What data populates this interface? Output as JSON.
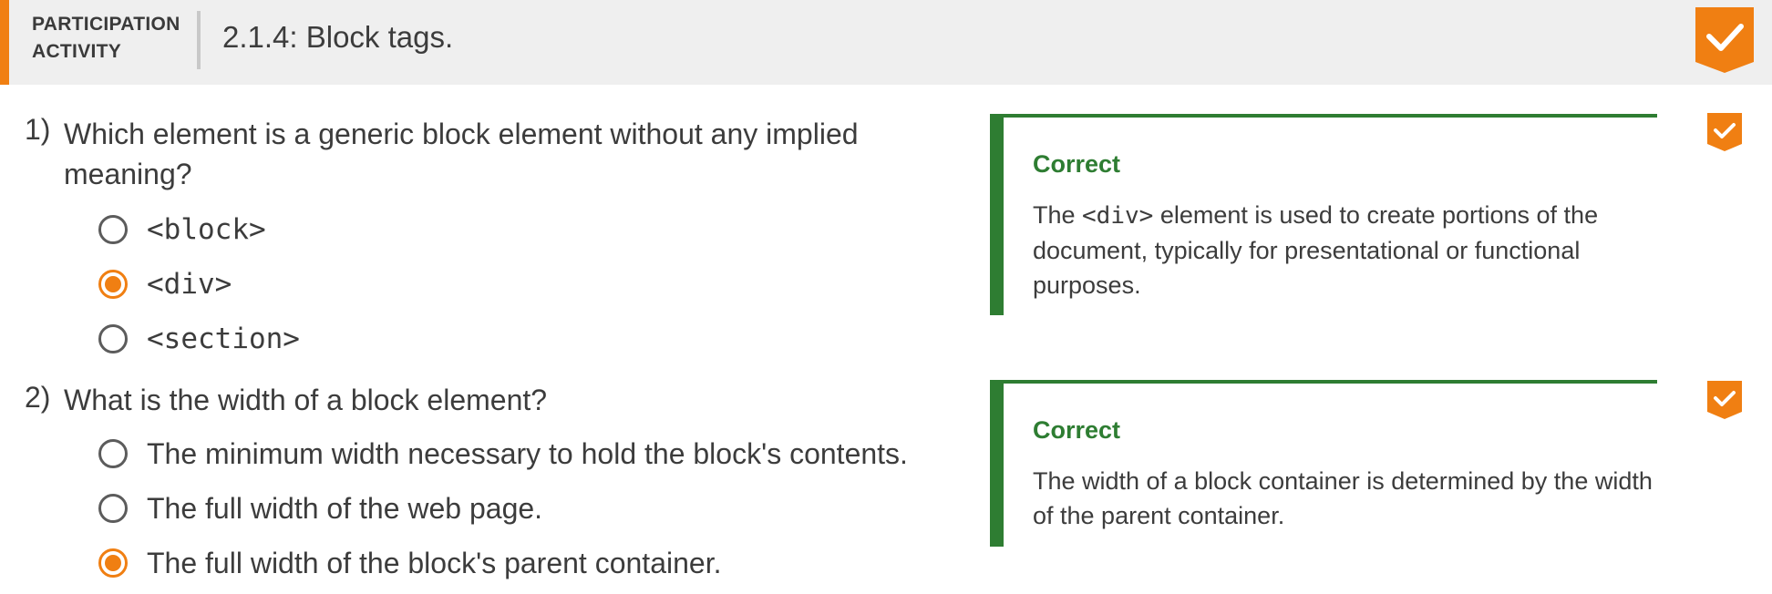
{
  "header": {
    "participation_line1": "PARTICIPATION",
    "participation_line2": "ACTIVITY",
    "title": "2.1.4: Block tags.",
    "completion_icon": "check-badge-icon"
  },
  "colors": {
    "accent": "#f07f12",
    "correct": "#2e7d32",
    "header_bg": "#efefef",
    "text": "#3c3c3c"
  },
  "questions": [
    {
      "number": "1)",
      "text": "Which element is a generic block element without any implied meaning?",
      "options": [
        {
          "label": "<block>",
          "selected": false
        },
        {
          "label": "<div>",
          "selected": true
        },
        {
          "label": "<section>",
          "selected": false
        }
      ],
      "feedback": {
        "title": "Correct",
        "body_before": "The ",
        "body_code": "<div>",
        "body_after": " element is used to create portions of the document, typically for presentational or functional purposes."
      },
      "status_icon": "check-badge-icon"
    },
    {
      "number": "2)",
      "text": "What is the width of a block element?",
      "options": [
        {
          "label": "The minimum width necessary to hold the block's contents.",
          "selected": false
        },
        {
          "label": "The full width of the web page.",
          "selected": false
        },
        {
          "label": "The full width of the block's parent container.",
          "selected": true
        }
      ],
      "feedback": {
        "title": "Correct",
        "body": "The width of a block container is determined by the width of the parent container."
      },
      "status_icon": "check-badge-icon"
    }
  ]
}
